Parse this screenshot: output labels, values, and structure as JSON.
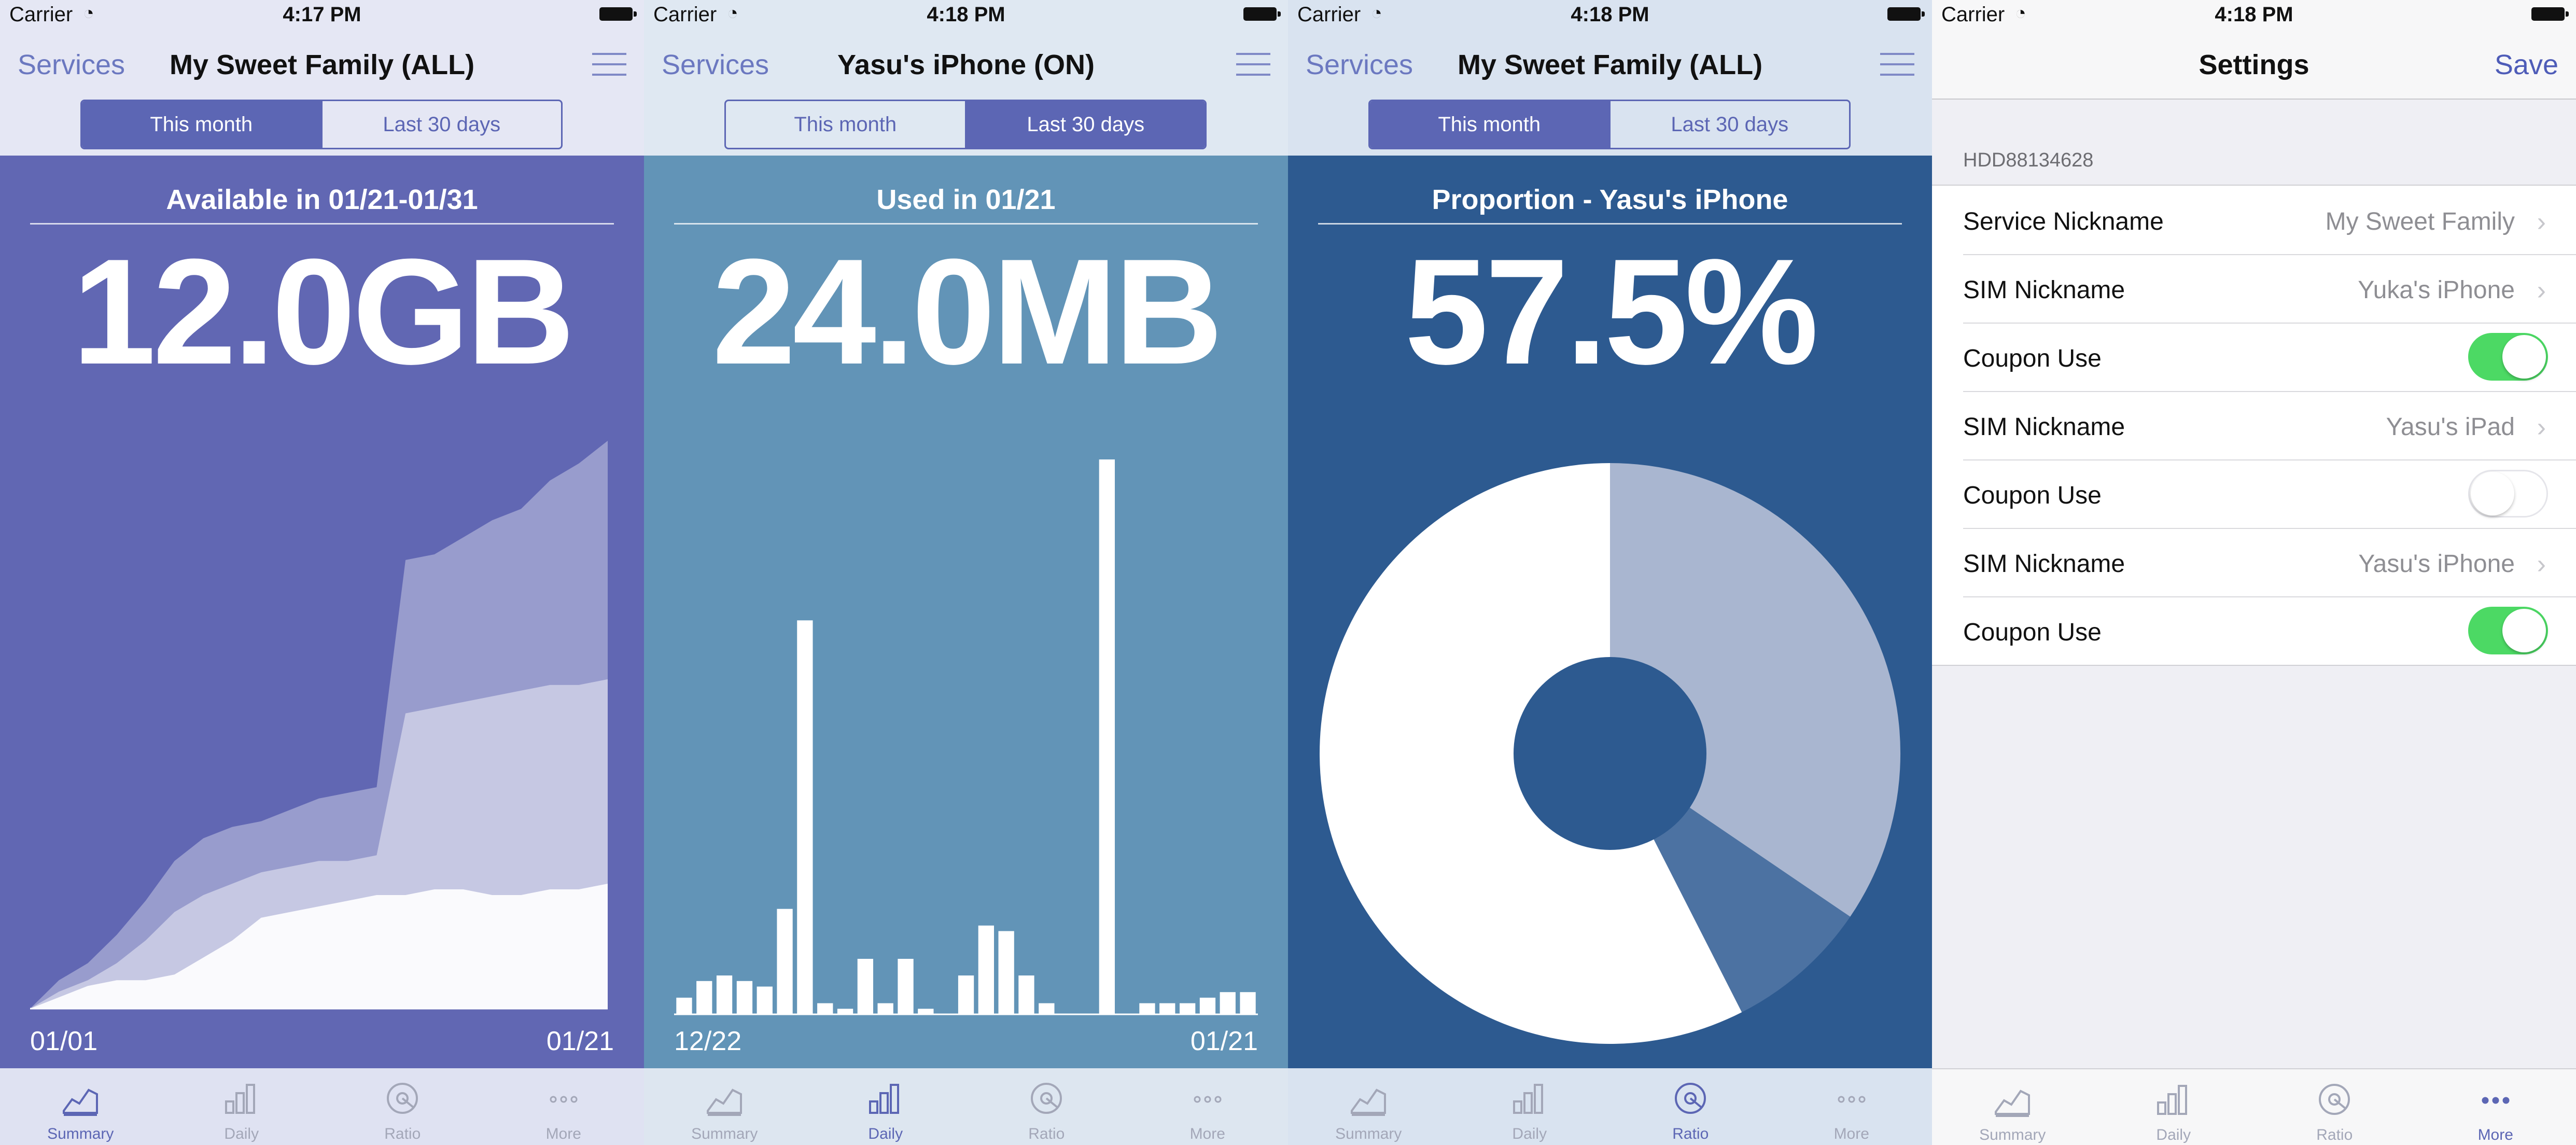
{
  "colors": {
    "accent": "#5c66b4",
    "screen1_bg": "#6167b3",
    "screen2_bg": "#6294b7",
    "screen3_bg": "#2d5a90",
    "tabbar_bg": "#dfe2f2"
  },
  "status": [
    {
      "carrier": "Carrier",
      "time": "4:17 PM"
    },
    {
      "carrier": "Carrier",
      "time": "4:18 PM"
    },
    {
      "carrier": "Carrier",
      "time": "4:18 PM"
    },
    {
      "carrier": "Carrier",
      "time": "4:18 PM"
    }
  ],
  "screens": [
    {
      "nav": {
        "back": "Services",
        "title": "My Sweet Family (ALL)"
      },
      "segments": [
        "This month",
        "Last 30 days"
      ],
      "active_segment": 0,
      "label": "Available in 01/21-01/31",
      "value": "12.0GB",
      "x_start": "01/01",
      "x_end": "01/21"
    },
    {
      "nav": {
        "back": "Services",
        "title": "Yasu's iPhone (ON)"
      },
      "segments": [
        "This month",
        "Last 30 days"
      ],
      "active_segment": 1,
      "label": "Used in 01/21",
      "value": "24.0MB",
      "x_start": "12/22",
      "x_end": "01/21"
    },
    {
      "nav": {
        "back": "Services",
        "title": "My Sweet Family (ALL)"
      },
      "segments": [
        "This month",
        "Last 30 days"
      ],
      "active_segment": 0,
      "label": "Proportion - Yasu's iPhone",
      "value": "57.5%"
    }
  ],
  "tabs": [
    "Summary",
    "Daily",
    "Ratio",
    "More"
  ],
  "active_tabs": [
    0,
    1,
    2,
    3
  ],
  "settings": {
    "title": "Settings",
    "save": "Save",
    "section": "HDD88134628",
    "rows": [
      {
        "label": "Service Nickname",
        "value": "My Sweet Family",
        "type": "link"
      },
      {
        "label": "SIM Nickname",
        "value": "Yuka's iPhone",
        "type": "link"
      },
      {
        "label": "Coupon Use",
        "type": "toggle",
        "on": true
      },
      {
        "label": "SIM Nickname",
        "value": "Yasu's iPad",
        "type": "link"
      },
      {
        "label": "Coupon Use",
        "type": "toggle",
        "on": false
      },
      {
        "label": "SIM Nickname",
        "value": "Yasu's iPhone",
        "type": "link"
      },
      {
        "label": "Coupon Use",
        "type": "toggle",
        "on": true
      }
    ]
  },
  "chart_data": [
    {
      "type": "area",
      "x": [
        "01/01",
        "01/21"
      ],
      "series": [
        {
          "values": [
            0,
            0.02,
            0.04,
            0.05,
            0.05,
            0.06,
            0.09,
            0.12,
            0.16,
            0.17,
            0.18,
            0.19,
            0.2,
            0.2,
            0.21,
            0.21,
            0.2,
            0.2,
            0.21,
            0.21,
            0.22
          ]
        },
        {
          "values": [
            0,
            0.03,
            0.05,
            0.08,
            0.12,
            0.17,
            0.2,
            0.22,
            0.24,
            0.25,
            0.26,
            0.26,
            0.27,
            0.52,
            0.53,
            0.54,
            0.55,
            0.56,
            0.57,
            0.57,
            0.58
          ]
        },
        {
          "values": [
            0,
            0.05,
            0.08,
            0.13,
            0.19,
            0.26,
            0.3,
            0.32,
            0.33,
            0.35,
            0.37,
            0.38,
            0.39,
            0.79,
            0.8,
            0.83,
            0.86,
            0.88,
            0.93,
            0.96,
            1.0
          ]
        }
      ]
    },
    {
      "type": "bar",
      "x": [
        "12/22",
        "01/21"
      ],
      "values": [
        0.03,
        0.06,
        0.07,
        0.06,
        0.05,
        0.19,
        0.71,
        0.02,
        0.01,
        0.1,
        0.02,
        0.1,
        0.01,
        0,
        0.07,
        0.16,
        0.15,
        0.07,
        0.02,
        0,
        0,
        1.0,
        0,
        0.02,
        0.02,
        0.02,
        0.03,
        0.04,
        0.04
      ]
    },
    {
      "type": "pie",
      "values": [
        34.5,
        8.0,
        57.5
      ],
      "colors": [
        "#a9b6d0",
        "#4c72a2",
        "#ffffff"
      ]
    }
  ]
}
